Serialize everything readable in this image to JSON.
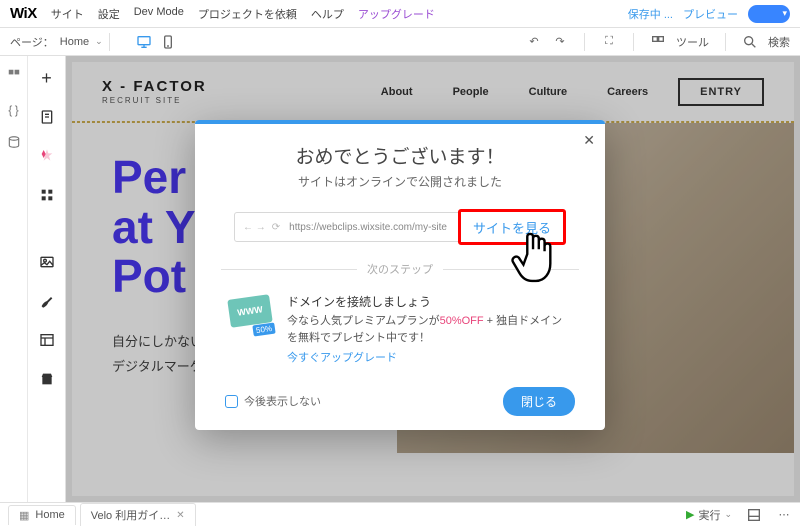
{
  "topbar": {
    "logo": "WiX",
    "menu": [
      "サイト",
      "設定",
      "Dev Mode",
      "プロジェクトを依頼",
      "ヘルプ"
    ],
    "upgrade": "アップグレード",
    "saving": "保存中",
    "preview": "プレビュー"
  },
  "secondbar": {
    "page_label": "ページ：",
    "page_name": "Home",
    "tools": "ツール",
    "search": "検索"
  },
  "site": {
    "brand": "X - FACTOR",
    "brand_sub": "RECRUIT SITE",
    "nav": [
      "About",
      "People",
      "Culture",
      "Careers"
    ],
    "entry": "ENTRY",
    "hero_lines": [
      "Per",
      "at Y",
      "Pot"
    ],
    "hero_jp1": "自分にしかない可能性で、",
    "hero_jp2": "デジタルマーケティングの業界に変化を。"
  },
  "modal": {
    "congrats": "おめでとうございます！",
    "sub": "サイトはオンラインで公開されました",
    "url": "https://webclips.wixsite.com/my-site",
    "view_site": "サイトを見る",
    "next_steps": "次のステップ",
    "domain_title": "ドメインを接続しましょう",
    "domain_text1": "今なら人気プレミアムプランが",
    "domain_off": "50%OFF",
    "domain_text2": " + 独自ドメインを無料でプレゼント中です！",
    "upgrade_now": "今すぐアップグレード",
    "icon_www": "WWW",
    "icon_tag": "50%",
    "dont_show": "今後表示しない",
    "close": "閉じる"
  },
  "bottombar": {
    "home": "Home",
    "velo": "Velo 利用ガイ…",
    "run": "実行"
  }
}
